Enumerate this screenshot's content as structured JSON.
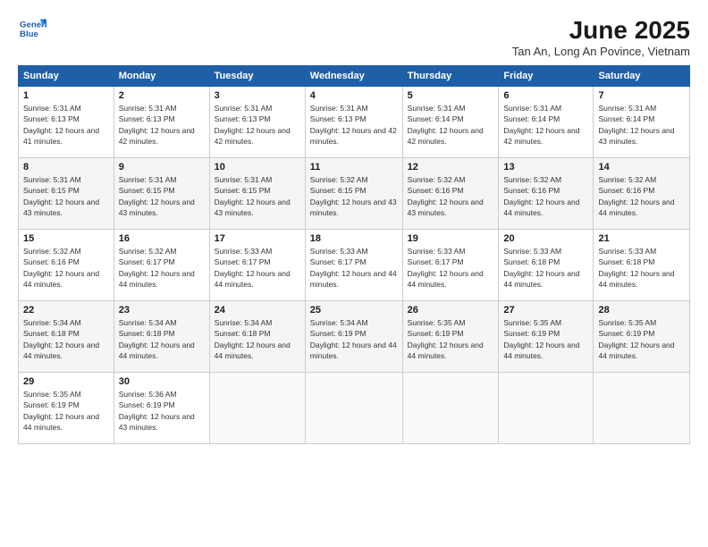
{
  "logo": {
    "line1": "General",
    "line2": "Blue"
  },
  "title": "June 2025",
  "subtitle": "Tan An, Long An Povince, Vietnam",
  "days_of_week": [
    "Sunday",
    "Monday",
    "Tuesday",
    "Wednesday",
    "Thursday",
    "Friday",
    "Saturday"
  ],
  "weeks": [
    [
      {
        "day": "1",
        "sunrise": "5:31 AM",
        "sunset": "6:13 PM",
        "daylight": "12 hours and 41 minutes."
      },
      {
        "day": "2",
        "sunrise": "5:31 AM",
        "sunset": "6:13 PM",
        "daylight": "12 hours and 42 minutes."
      },
      {
        "day": "3",
        "sunrise": "5:31 AM",
        "sunset": "6:13 PM",
        "daylight": "12 hours and 42 minutes."
      },
      {
        "day": "4",
        "sunrise": "5:31 AM",
        "sunset": "6:13 PM",
        "daylight": "12 hours and 42 minutes."
      },
      {
        "day": "5",
        "sunrise": "5:31 AM",
        "sunset": "6:14 PM",
        "daylight": "12 hours and 42 minutes."
      },
      {
        "day": "6",
        "sunrise": "5:31 AM",
        "sunset": "6:14 PM",
        "daylight": "12 hours and 42 minutes."
      },
      {
        "day": "7",
        "sunrise": "5:31 AM",
        "sunset": "6:14 PM",
        "daylight": "12 hours and 43 minutes."
      }
    ],
    [
      {
        "day": "8",
        "sunrise": "5:31 AM",
        "sunset": "6:15 PM",
        "daylight": "12 hours and 43 minutes."
      },
      {
        "day": "9",
        "sunrise": "5:31 AM",
        "sunset": "6:15 PM",
        "daylight": "12 hours and 43 minutes."
      },
      {
        "day": "10",
        "sunrise": "5:31 AM",
        "sunset": "6:15 PM",
        "daylight": "12 hours and 43 minutes."
      },
      {
        "day": "11",
        "sunrise": "5:32 AM",
        "sunset": "6:15 PM",
        "daylight": "12 hours and 43 minutes."
      },
      {
        "day": "12",
        "sunrise": "5:32 AM",
        "sunset": "6:16 PM",
        "daylight": "12 hours and 43 minutes."
      },
      {
        "day": "13",
        "sunrise": "5:32 AM",
        "sunset": "6:16 PM",
        "daylight": "12 hours and 44 minutes."
      },
      {
        "day": "14",
        "sunrise": "5:32 AM",
        "sunset": "6:16 PM",
        "daylight": "12 hours and 44 minutes."
      }
    ],
    [
      {
        "day": "15",
        "sunrise": "5:32 AM",
        "sunset": "6:16 PM",
        "daylight": "12 hours and 44 minutes."
      },
      {
        "day": "16",
        "sunrise": "5:32 AM",
        "sunset": "6:17 PM",
        "daylight": "12 hours and 44 minutes."
      },
      {
        "day": "17",
        "sunrise": "5:33 AM",
        "sunset": "6:17 PM",
        "daylight": "12 hours and 44 minutes."
      },
      {
        "day": "18",
        "sunrise": "5:33 AM",
        "sunset": "6:17 PM",
        "daylight": "12 hours and 44 minutes."
      },
      {
        "day": "19",
        "sunrise": "5:33 AM",
        "sunset": "6:17 PM",
        "daylight": "12 hours and 44 minutes."
      },
      {
        "day": "20",
        "sunrise": "5:33 AM",
        "sunset": "6:18 PM",
        "daylight": "12 hours and 44 minutes."
      },
      {
        "day": "21",
        "sunrise": "5:33 AM",
        "sunset": "6:18 PM",
        "daylight": "12 hours and 44 minutes."
      }
    ],
    [
      {
        "day": "22",
        "sunrise": "5:34 AM",
        "sunset": "6:18 PM",
        "daylight": "12 hours and 44 minutes."
      },
      {
        "day": "23",
        "sunrise": "5:34 AM",
        "sunset": "6:18 PM",
        "daylight": "12 hours and 44 minutes."
      },
      {
        "day": "24",
        "sunrise": "5:34 AM",
        "sunset": "6:18 PM",
        "daylight": "12 hours and 44 minutes."
      },
      {
        "day": "25",
        "sunrise": "5:34 AM",
        "sunset": "6:19 PM",
        "daylight": "12 hours and 44 minutes."
      },
      {
        "day": "26",
        "sunrise": "5:35 AM",
        "sunset": "6:19 PM",
        "daylight": "12 hours and 44 minutes."
      },
      {
        "day": "27",
        "sunrise": "5:35 AM",
        "sunset": "6:19 PM",
        "daylight": "12 hours and 44 minutes."
      },
      {
        "day": "28",
        "sunrise": "5:35 AM",
        "sunset": "6:19 PM",
        "daylight": "12 hours and 44 minutes."
      }
    ],
    [
      {
        "day": "29",
        "sunrise": "5:35 AM",
        "sunset": "6:19 PM",
        "daylight": "12 hours and 44 minutes."
      },
      {
        "day": "30",
        "sunrise": "5:36 AM",
        "sunset": "6:19 PM",
        "daylight": "12 hours and 43 minutes."
      },
      null,
      null,
      null,
      null,
      null
    ]
  ]
}
